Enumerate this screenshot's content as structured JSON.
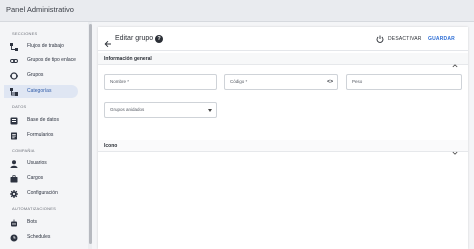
{
  "app": {
    "title": "Panel Administrativo"
  },
  "sidebar": {
    "sections": [
      {
        "label": "SECCIONES"
      },
      {
        "label": "DATOS"
      },
      {
        "label": "COMPAÑIA"
      },
      {
        "label": "AUTOMATIZACIONES"
      }
    ],
    "items": [
      {
        "label": "Flujos de trabajo",
        "icon": "workflow-icon"
      },
      {
        "label": "Grupos de tipo enlace",
        "icon": "link-icon"
      },
      {
        "label": "Grupos",
        "icon": "group-icon"
      },
      {
        "label": "Categorías",
        "icon": "category-icon",
        "active": true
      },
      {
        "label": "Base de datos",
        "icon": "database-icon"
      },
      {
        "label": "Formularios",
        "icon": "form-icon"
      },
      {
        "label": "Usuarios",
        "icon": "user-icon"
      },
      {
        "label": "Cargos",
        "icon": "badge-icon"
      },
      {
        "label": "Configuración",
        "icon": "gear-icon"
      },
      {
        "label": "Bots",
        "icon": "bot-icon"
      },
      {
        "label": "Schedules",
        "icon": "clock-icon"
      }
    ]
  },
  "editor": {
    "title": "Editar grupo",
    "help_glyph": "?",
    "deactivate_label": "DESACTIVAR",
    "save_label": "GUARDAR",
    "general_section": "Información general",
    "fields": {
      "nombre_placeholder": "Nombre *",
      "codigo_placeholder": "Código *",
      "codigo_icon": "<>",
      "peso_placeholder": "Peso",
      "grupos_placeholder": "Grupos anidados"
    },
    "icon_section": "Icono"
  },
  "colors": {
    "accent": "#2f6fd6",
    "active_bg": "#dfe6f3",
    "active_text": "#2f5ba8"
  }
}
